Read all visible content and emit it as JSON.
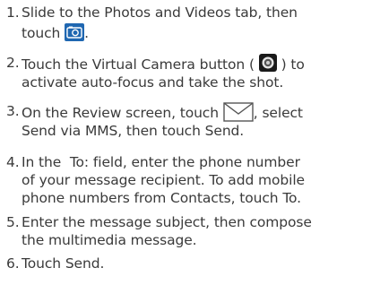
{
  "steps": [
    {
      "num": "1.",
      "text_a": "Slide to the Photos and Videos tab, then",
      "text_b": "touch",
      "text_c": "."
    },
    {
      "num": "2.",
      "text_a": "Touch the Virtual Camera button (",
      "text_b": ") to",
      "text_c": "activate auto-focus and take the shot."
    },
    {
      "num": "3.",
      "text_a": "On the Review screen, touch",
      "text_b": ", select",
      "text_c": "Send via MMS, then touch Send."
    },
    {
      "num": "4.",
      "line1": "In the  To: field, enter the phone number",
      "line2": "of your message recipient. To add mobile",
      "line3": "phone numbers from Contacts, touch To."
    },
    {
      "num": "5.",
      "line1": "Enter the message subject, then compose",
      "line2": "the multimedia message."
    },
    {
      "num": "6.",
      "line1": "Touch Send."
    }
  ],
  "icons": {
    "camera_tab": "camera-tab-icon",
    "virtual_camera": "virtual-camera-icon",
    "send_mail": "envelope-icon"
  },
  "colors": {
    "text": "#3a3a3a",
    "camera_tab_bg": "#1f67b1",
    "virtual_camera_bg": "#1a1a1a"
  }
}
